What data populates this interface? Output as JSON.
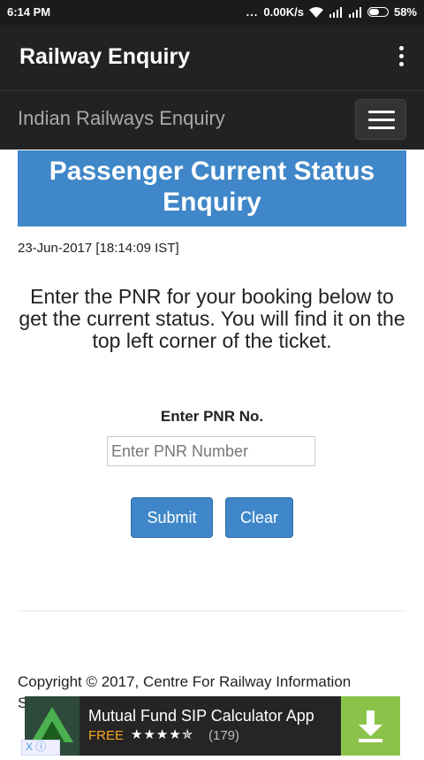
{
  "status_bar": {
    "time": "6:14 PM",
    "more": "...",
    "speed": "0.00K/s",
    "battery": "58%"
  },
  "app_bar": {
    "title": "Railway Enquiry",
    "menu_icon": "overflow-menu-icon"
  },
  "site_nav": {
    "brand": "Indian Railways Enquiry",
    "toggle_icon": "hamburger-icon"
  },
  "banner": {
    "line1": "Passenger Current Status",
    "line2": "Enquiry"
  },
  "timestamp": "23-Jun-2017 [18:14:09 IST]",
  "instructions": "Enter the PNR for your booking below to get the current status. You will find it on the top left corner of the ticket.",
  "form": {
    "label": "Enter PNR No.",
    "placeholder": "Enter PNR Number",
    "value": "",
    "submit_label": "Submit",
    "clear_label": "Clear"
  },
  "footer": {
    "copyright": "Copyright © 2017, Centre For Railway Information",
    "copyright_cont": "S"
  },
  "ad": {
    "app_name": "Mutual Fund SIP Calculator App",
    "price": "FREE",
    "stars": "★★★★✯",
    "reviews": "(179)",
    "download_icon": "download-icon",
    "adchoice": "X ⓘ"
  },
  "colors": {
    "primary": "#3f87c8",
    "appbar": "#222222",
    "download": "#8bc34a",
    "free": "#f5a623"
  }
}
